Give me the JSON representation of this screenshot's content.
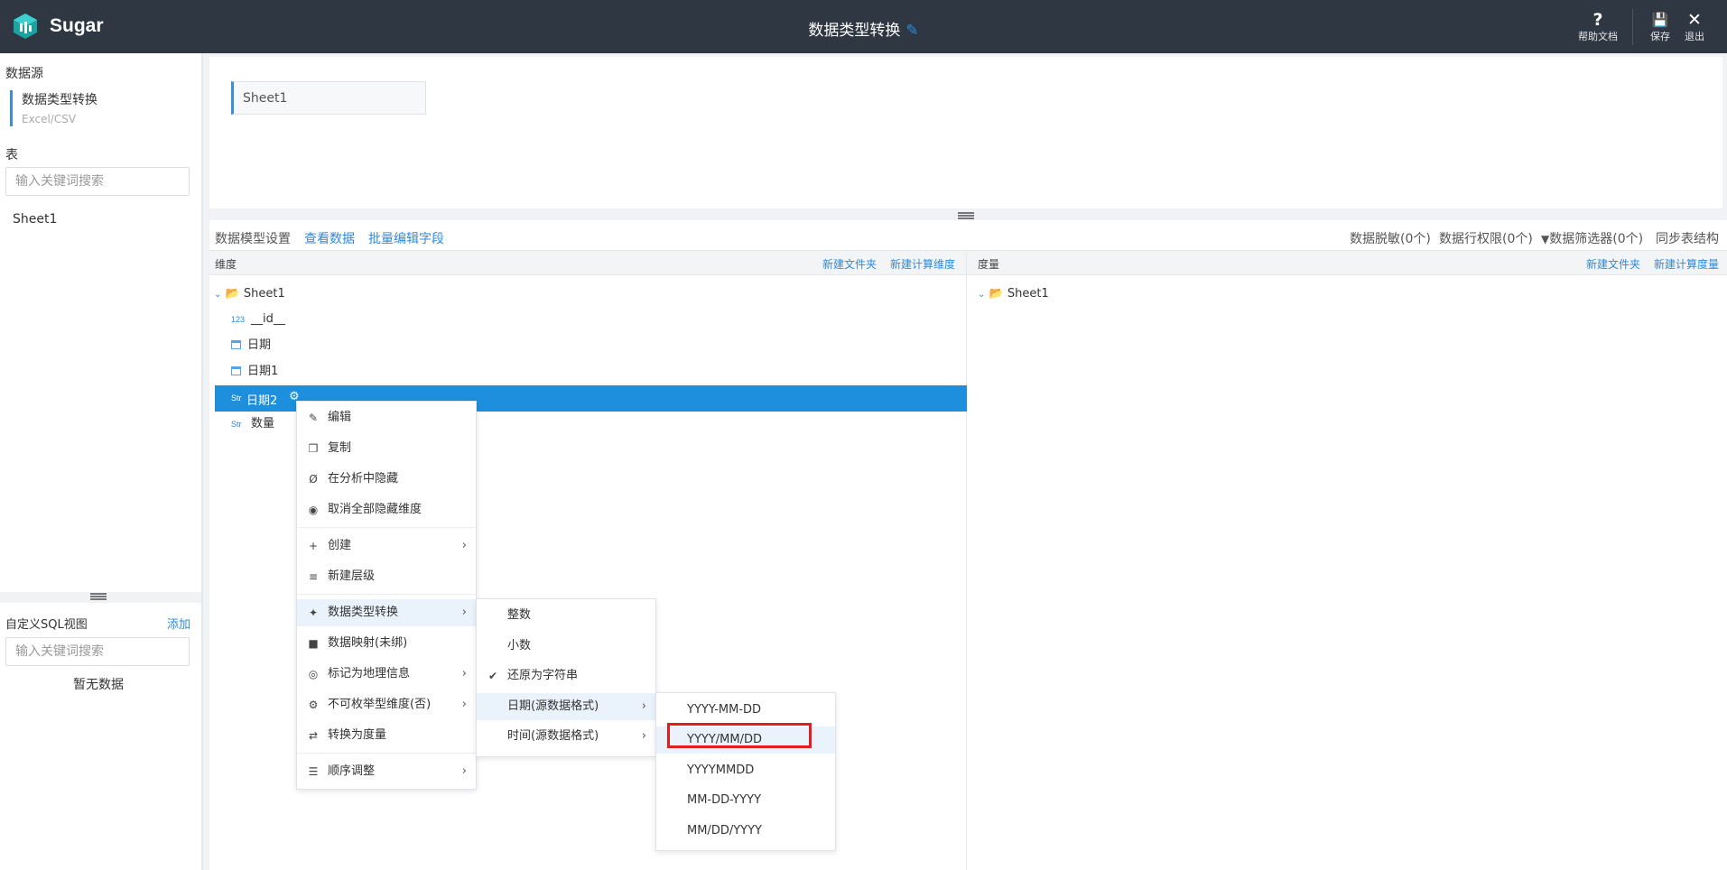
{
  "topbar": {
    "app_name": "Sugar",
    "doc_title": "数据类型转换",
    "help_label": "帮助文档",
    "save_label": "保存",
    "exit_label": "退出",
    "bg_color": "#2f3742",
    "accent": "#2a8be0"
  },
  "sidebar": {
    "datasource_heading": "数据源",
    "datasource_name": "数据类型转换",
    "datasource_type": "Excel/CSV",
    "table_heading": "表",
    "table_search_placeholder": "输入关键词搜索",
    "tables": [
      "Sheet1"
    ],
    "sql_heading": "自定义SQL视图",
    "sql_add": "添加",
    "sql_search_placeholder": "输入关键词搜索",
    "sql_empty": "暂无数据"
  },
  "canvas": {
    "sheet_chip": "Sheet1"
  },
  "model": {
    "tabs": [
      "数据模型设置",
      "查看数据",
      "批量编辑字段"
    ],
    "right_actions": [
      "数据脱敏(0个)",
      "数据行权限(0个)",
      "数据筛选器(0个)",
      "同步表结构"
    ],
    "dimension_head": "维度",
    "measure_head": "度量",
    "new_folder": "新建文件夹",
    "new_calc_dim": "新建计算维度",
    "new_calc_measure": "新建计算度量",
    "dim_root": "Sheet1",
    "measure_root": "Sheet1",
    "fields": [
      {
        "type": "123",
        "name": "__id__"
      },
      {
        "type": "date",
        "name": "日期"
      },
      {
        "type": "date",
        "name": "日期1"
      },
      {
        "type": "Str",
        "name": "日期2"
      },
      {
        "type": "Str",
        "name": "数量"
      }
    ]
  },
  "context_menu": {
    "items": [
      "编辑",
      "复制",
      "在分析中隐藏",
      "取消全部隐藏维度",
      "创建",
      "新建层级",
      "数据类型转换",
      "数据映射(未绑)",
      "标记为地理信息",
      "不可枚举型维度(否)",
      "转换为度量",
      "顺序调整"
    ]
  },
  "type_menu": {
    "items": [
      "整数",
      "小数",
      "还原为字符串",
      "日期(源数据格式)",
      "时间(源数据格式)"
    ]
  },
  "date_menu": {
    "items": [
      "YYYY-MM-DD",
      "YYYY/MM/DD",
      "YYYYMMDD",
      "MM-DD-YYYY",
      "MM/DD/YYYY"
    ]
  }
}
